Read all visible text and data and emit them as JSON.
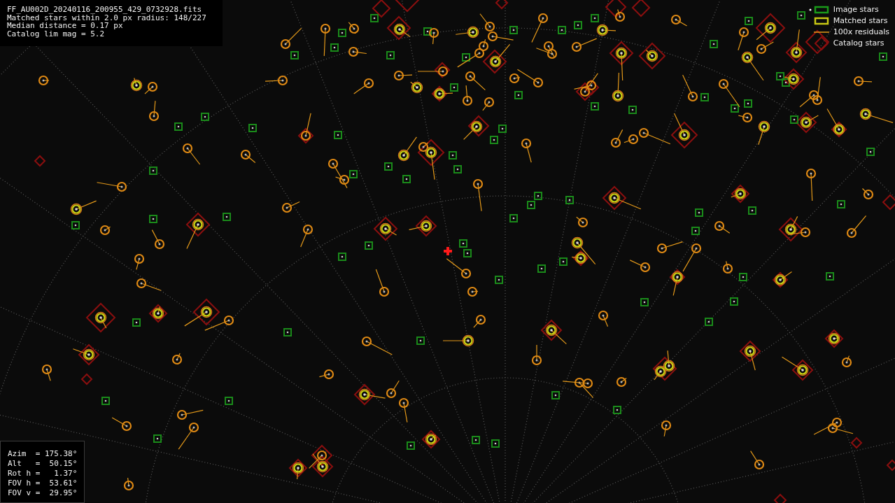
{
  "info_panel": {
    "lines": [
      "FF_AU002D_20240116_200955_429_0732928.fits",
      "Matched stars within 2.0 px radius: 148/227",
      "Median distance = 0.17 px",
      "Catalog lim mag = 5.2"
    ]
  },
  "legend": [
    {
      "kind": "image",
      "label": "Image stars"
    },
    {
      "kind": "matched",
      "label": "Matched stars"
    },
    {
      "kind": "residual",
      "label": "100x residuals"
    },
    {
      "kind": "catalog",
      "label": "Catalog stars"
    }
  ],
  "pointing_panel": {
    "rows": [
      "Azim  = 175.38°",
      "Alt   =  50.15°",
      "Rot h =   1.37°",
      "FOV h =  53.61°",
      "FOV v =  29.95°"
    ]
  }
}
